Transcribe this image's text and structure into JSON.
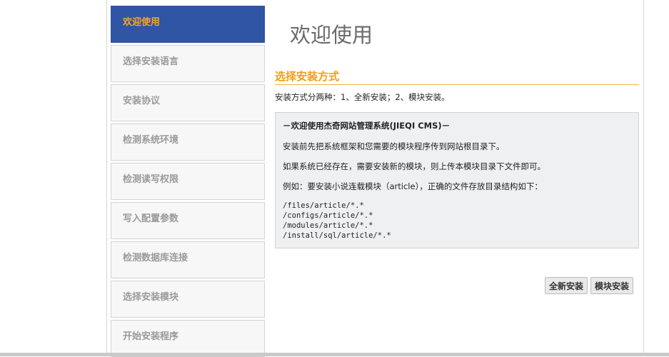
{
  "sidebar": {
    "steps": [
      {
        "label": "欢迎使用"
      },
      {
        "label": "选择安装语言"
      },
      {
        "label": "安装协议"
      },
      {
        "label": "检测系统环境"
      },
      {
        "label": "检测读写权限"
      },
      {
        "label": "写入配置参数"
      },
      {
        "label": "检测数据库连接"
      },
      {
        "label": "选择安装模块"
      },
      {
        "label": "开始安装程序"
      }
    ],
    "active_color": "#2f55a4",
    "active_label_color": "#f5a623"
  },
  "main": {
    "page_title": "欢迎使用",
    "section_title": "选择安装方式",
    "intro": "安装方式分两种：1、全新安装；2、模块安装。",
    "info": {
      "title": "－欢迎使用杰奇网站管理系统(JIEQI CMS)－",
      "line1": "安装前先把系统框架和您需要的模块程序传到网站根目录下。",
      "line2": "如果系统已经存在，需要安装新的模块，则上传本模块目录下文件即可。",
      "line3": "例如：要安装小说连载模块（article），正确的文件存放目录结构如下：",
      "paths": [
        "/files/article/*.*",
        "/configs/article/*.*",
        "/modules/article/*.*",
        "/install/sql/article/*.*"
      ]
    },
    "buttons": {
      "full_install": "全新安装",
      "module_install": "模块安装"
    }
  }
}
